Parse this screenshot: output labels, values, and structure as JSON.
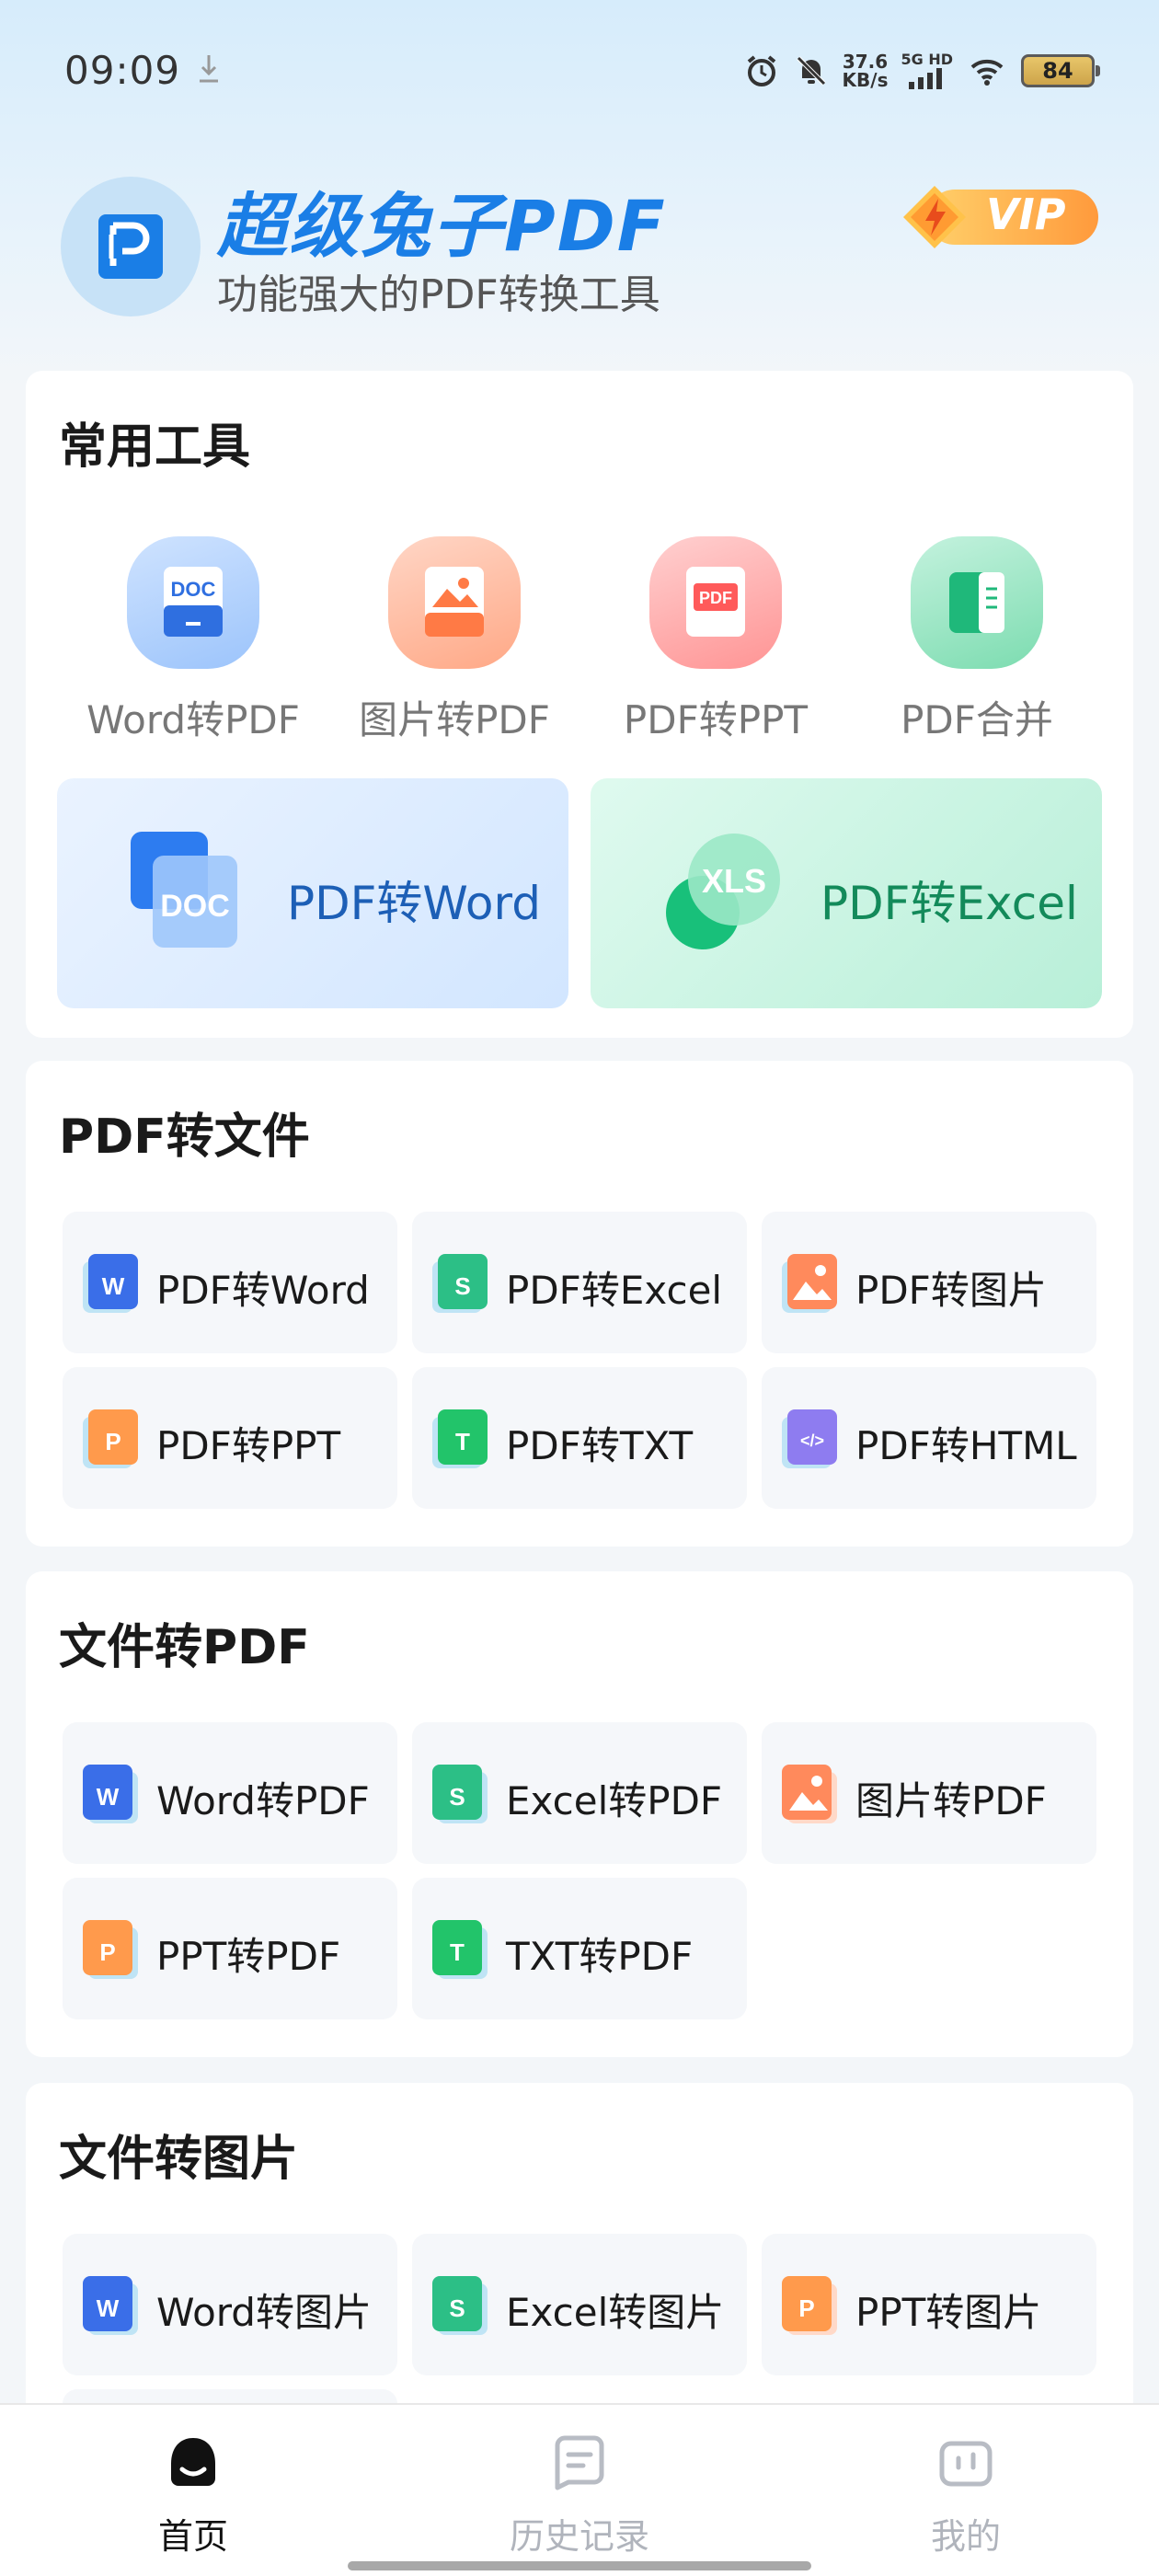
{
  "status_bar": {
    "time": "09:09",
    "net_speed_value": "37.6",
    "net_speed_unit": "KB/s",
    "net_label_top": "5G HD",
    "battery": "84"
  },
  "header": {
    "app_title": "超级兔子PDF",
    "subtitle": "功能强大的PDF转换工具",
    "vip_label": "VIP"
  },
  "common_tools": {
    "title": "常用工具",
    "tools": [
      {
        "label": "Word转PDF",
        "icon": "doc-icon",
        "badge": "DOC"
      },
      {
        "label": "图片转PDF",
        "icon": "image-icon"
      },
      {
        "label": "PDF转PPT",
        "icon": "pdf-icon",
        "badge": "PDF"
      },
      {
        "label": "PDF合并",
        "icon": "merge-icon"
      }
    ],
    "big_buttons": [
      {
        "label": "PDF转Word",
        "badge": "DOC"
      },
      {
        "label": "PDF转Excel",
        "badge": "XLS"
      }
    ]
  },
  "pdf_to_file": {
    "title": "PDF转文件",
    "items": [
      {
        "label": "PDF转Word",
        "letter": "W"
      },
      {
        "label": "PDF转Excel",
        "letter": "S"
      },
      {
        "label": "PDF转图片",
        "letter": ""
      },
      {
        "label": "PDF转PPT",
        "letter": "P"
      },
      {
        "label": "PDF转TXT",
        "letter": "T"
      },
      {
        "label": "PDF转HTML",
        "letter": "</>"
      }
    ]
  },
  "file_to_pdf": {
    "title": "文件转PDF",
    "items": [
      {
        "label": "Word转PDF",
        "letter": "W"
      },
      {
        "label": "Excel转PDF",
        "letter": "S"
      },
      {
        "label": "图片转PDF",
        "letter": ""
      },
      {
        "label": "PPT转PDF",
        "letter": "P"
      },
      {
        "label": "TXT转PDF",
        "letter": "T"
      }
    ]
  },
  "file_to_image": {
    "title": "文件转图片",
    "items": [
      {
        "label": "Word转图片",
        "letter": "W"
      },
      {
        "label": "Excel转图片",
        "letter": "S"
      },
      {
        "label": "PPT转图片",
        "letter": "P"
      }
    ]
  },
  "bottom_nav": {
    "items": [
      {
        "label": "首页",
        "icon": "home-icon",
        "active": true
      },
      {
        "label": "历史记录",
        "icon": "history-icon",
        "active": false
      },
      {
        "label": "我的",
        "icon": "profile-icon",
        "active": false
      }
    ]
  },
  "colors": {
    "primary": "#1a7ee6",
    "word_blue": "#3a6ee8",
    "excel_green": "#2cbf86",
    "image_orange": "#ff8a5c",
    "ppt_orange": "#ff9a4c",
    "txt_green": "#22c46a",
    "html_purple": "#8e7cf0"
  }
}
